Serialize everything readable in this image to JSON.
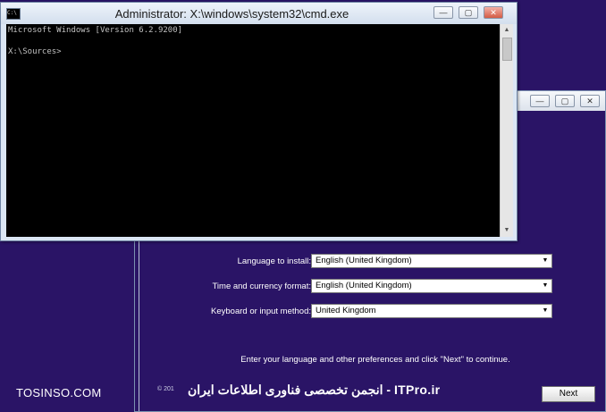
{
  "cmd": {
    "title": "Administrator: X:\\windows\\system32\\cmd.exe",
    "icon_label": "C:\\",
    "console_lines": [
      "Microsoft Windows [Version 6.2.9200]",
      "",
      "X:\\Sources>"
    ],
    "minimize_glyph": "—",
    "maximize_glyph": "▢",
    "close_glyph": "✕",
    "scroll_up_glyph": "▲",
    "scroll_down_glyph": "▼"
  },
  "setup": {
    "minimize_glyph": "—",
    "maximize_glyph": "▢",
    "close_glyph": "✕",
    "language_label": "Language to install:",
    "language_value": "English (United Kingdom)",
    "time_label": "Time and currency format:",
    "time_value": "English (United Kingdom)",
    "keyboard_label": "Keyboard or input method:",
    "keyboard_value": "United Kingdom",
    "instruction": "Enter your language and other preferences and click \"Next\" to continue.",
    "copyright": "© 201",
    "next_label": "Next"
  },
  "overlay": {
    "watermark_left": "TOSINSO.COM",
    "watermark_center": "انجمن تخصصی فناوری اطلاعات ایران - ITPro.ir"
  },
  "icons": {
    "dropdown": "chevron-down-icon",
    "cursor": "mouse-pointer-icon"
  }
}
